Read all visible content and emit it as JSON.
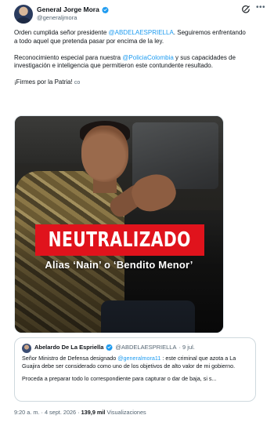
{
  "author": {
    "name": "General Jorge Mora",
    "handle": "@generaljmora"
  },
  "tweet": {
    "paragraph1_pre": "Orden cumplida señor presidente ",
    "paragraph1_mention": "@ABDELAESPRIELLA",
    "paragraph1_post": ". Seguiremos enfrentando a todo aquel que pretenda pasar por encima de la ley.",
    "paragraph2_pre": "Reconocimiento especial para nuestra ",
    "paragraph2_mention": "@PoliciaColombia",
    "paragraph2_post": " y sus capacidades de investigación e inteligencia que permitieron este contundente resultado.",
    "paragraph3": "¡Firmes por la Patria!",
    "translate_label": "co"
  },
  "media": {
    "banner": "NEUTRALIZADO",
    "subtitle": "Alias ‘Nain’ o ‘Bendito Menor’"
  },
  "quote": {
    "name": "Abelardo De La Espriella",
    "handle": "@ABDELAESPRIELLA",
    "date": "· 9 jul.",
    "text1_pre": "Señor Ministro de Defensa designado ",
    "text1_mention": "@generalmora11",
    "text1_post": " : este criminal que azota a La Guajira debe ser considerado como uno de los objetivos de alto valor de mi gobierno.",
    "text2": "Proceda a preparar todo lo correspondiente para capturar o dar de baja, si s..."
  },
  "footer": {
    "time": "9:20 a. m.",
    "sep1": " · ",
    "date": "4 sept. 2026",
    "sep2": " · ",
    "views": "139,9 mil",
    "views_label": " Visualizaciones"
  },
  "colors": {
    "link": "#1d9bf0",
    "banner": "#e0131c",
    "muted": "#536471"
  },
  "icons": [
    "verified-badge-icon",
    "grok-icon",
    "more-options-icon"
  ]
}
